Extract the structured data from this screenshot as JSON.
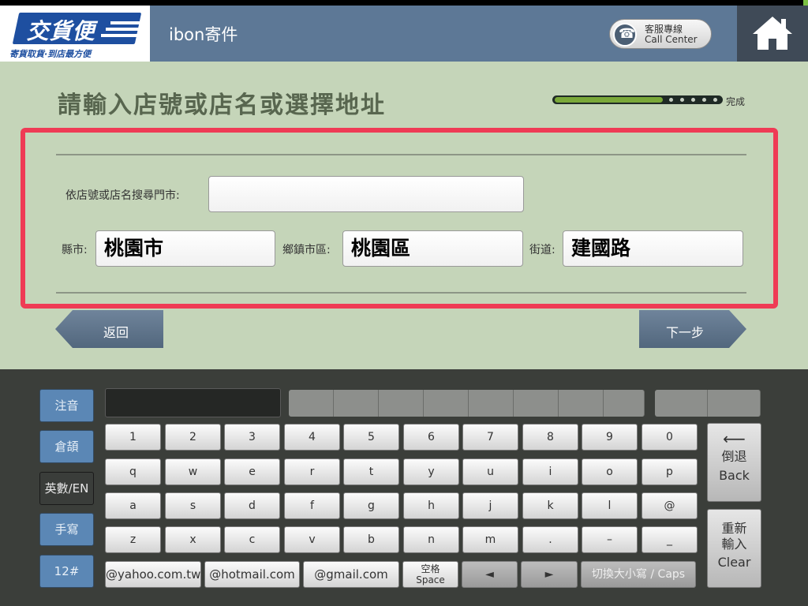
{
  "header": {
    "logo_text": "交貨便",
    "logo_subtitle": "寄貨取貨·到店最方便",
    "app_title": "ibon寄件",
    "call_center_zh": "客服專線",
    "call_center_en": "Call Center",
    "bg_color": "#5d7896"
  },
  "page": {
    "title": "請輸入店號或店名或選擇地址",
    "progress_fraction": 0.65,
    "progress_done_label": "完成"
  },
  "form": {
    "search_label": "依店號或店名搜尋門市:",
    "search_value": "",
    "county_label": "縣市:",
    "county_value": "桃園市",
    "district_label": "鄉鎮市區:",
    "district_value": "桃園區",
    "street_label": "街道:",
    "street_value": "建國路",
    "highlight_color": "#ef3b55"
  },
  "nav": {
    "back_label": "返回",
    "next_label": "下一步"
  },
  "keyboard": {
    "modes": [
      "注音",
      "倉頡",
      "英數/EN",
      "手寫",
      "12#"
    ],
    "active_mode": "英數/EN",
    "rows": [
      [
        "1",
        "2",
        "3",
        "4",
        "5",
        "6",
        "7",
        "8",
        "9",
        "0"
      ],
      [
        "q",
        "w",
        "e",
        "r",
        "t",
        "y",
        "u",
        "i",
        "o",
        "p"
      ],
      [
        "a",
        "s",
        "d",
        "f",
        "g",
        "h",
        "j",
        "k",
        "l",
        "@"
      ],
      [
        "z",
        "x",
        "c",
        "v",
        "b",
        "n",
        "m",
        ".",
        "–",
        "_"
      ]
    ],
    "email_keys": [
      "@yahoo.com.tw",
      "@hotmail.com",
      "@gmail.com"
    ],
    "space_zh": "空格",
    "space_en": "Space",
    "left_arrow": "◄",
    "right_arrow": "►",
    "caps_label": "切換大小寫 / Caps",
    "backspace_zh": "倒退",
    "backspace_en": "Back",
    "clear_zh_1": "重新",
    "clear_zh_2": "輸入",
    "clear_en": "Clear",
    "backspace_arrow": "⟵"
  }
}
